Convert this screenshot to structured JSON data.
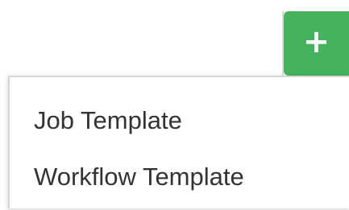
{
  "toolbar": {
    "add_button_label": "+",
    "add_button_color": "#45b25e"
  },
  "add_menu": {
    "items": [
      {
        "label": "Job Template"
      },
      {
        "label": "Workflow Template"
      }
    ]
  }
}
